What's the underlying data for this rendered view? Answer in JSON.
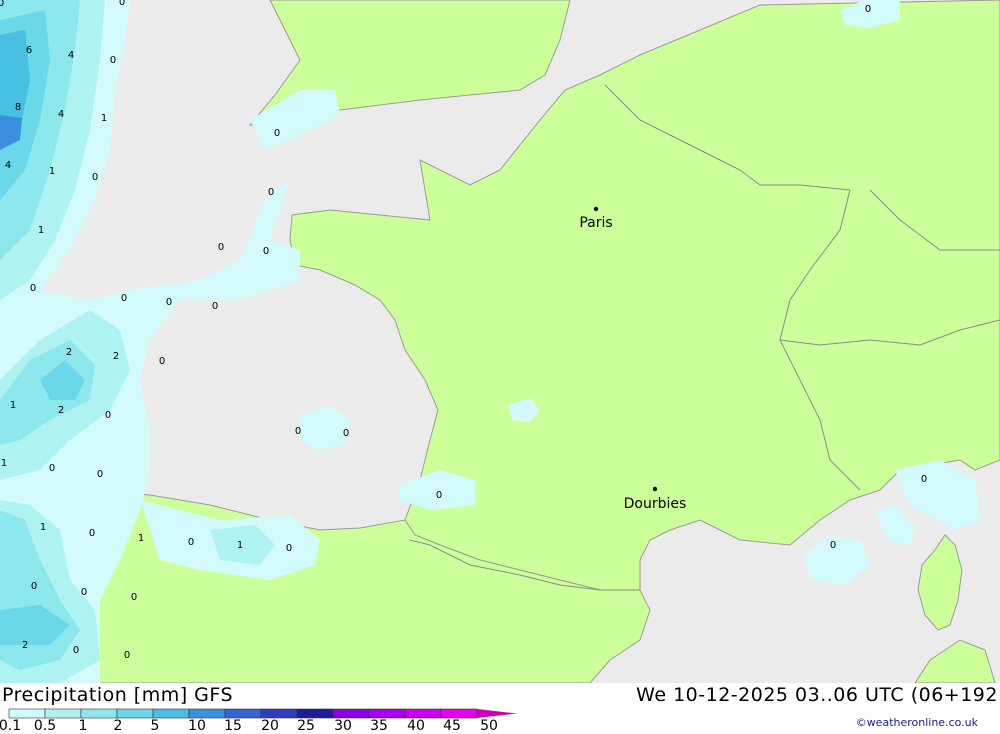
{
  "title": "Precipitation [mm] GFS",
  "valid_time": "We 10-12-2025 03..06 UTC (06+192",
  "credit": "©weatheronline.co.uk",
  "cities": [
    {
      "name": "Paris"
    },
    {
      "name": "Dourbies"
    }
  ],
  "legend": {
    "labels": [
      "0.1",
      "0.5",
      "1",
      "2",
      "5",
      "10",
      "15",
      "20",
      "25",
      "30",
      "35",
      "40",
      "45",
      "50"
    ],
    "colors": [
      "#d2fafa",
      "#aef2f2",
      "#8ce8ec",
      "#6ad8e8",
      "#48c0e4",
      "#3c8ee0",
      "#3664d6",
      "#2c3cc4",
      "#1c1c9e",
      "#8800e8",
      "#aa00ee",
      "#cc00f0",
      "#e800ee",
      "#c800b4"
    ]
  },
  "precip_values": [
    "0",
    "6",
    "4",
    "0",
    "8",
    "4",
    "1",
    "4",
    "1",
    "0",
    "1",
    "0",
    "0",
    "0",
    "0",
    "0",
    "0",
    "0",
    "0",
    "0",
    "2",
    "2",
    "0",
    "1",
    "2",
    "0",
    "0",
    "0",
    "1",
    "0",
    "0",
    "0",
    "0",
    "1",
    "0",
    "1",
    "1",
    "0",
    "2",
    "0",
    "0",
    "0",
    "0",
    "0",
    "0",
    "0",
    "0"
  ],
  "colors": {
    "land": "#ccff99",
    "sea": "#ebebeb",
    "border": "#8a8a8a"
  }
}
